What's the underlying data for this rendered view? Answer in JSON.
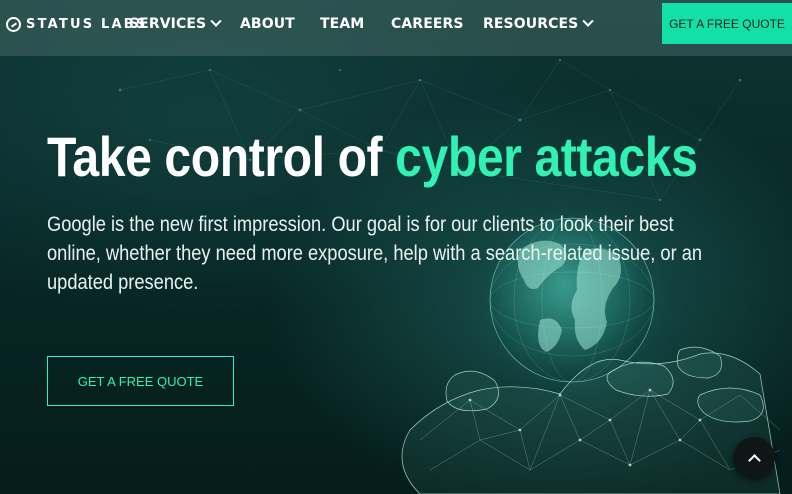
{
  "brand": {
    "name": "STATUS LABS",
    "logo_icon": "status-labs-logo-icon"
  },
  "nav": {
    "items": [
      {
        "label": "SERVICES",
        "has_dropdown": true
      },
      {
        "label": "ABOUT",
        "has_dropdown": false
      },
      {
        "label": "TEAM",
        "has_dropdown": false
      },
      {
        "label": "CAREERS",
        "has_dropdown": false
      },
      {
        "label": "RESOURCES",
        "has_dropdown": true
      }
    ],
    "cta_label": "GET A FREE QUOTE"
  },
  "hero": {
    "headline_plain": "Take control of",
    "headline_accent": "cyber attacks",
    "subtext": "Google is the new first impression. Our goal is for our clients to look their best online, whether they need more exposure, help with a search-related issue, or an updated presence.",
    "cta_label": "GET A FREE QUOTE",
    "background_image": "wireframe-hand-holding-globe"
  },
  "scroll_top": {
    "icon": "chevron-up-icon"
  },
  "colors": {
    "accent": "#2ff2b4",
    "cta_background": "#12e0a6",
    "background": "#06201f",
    "navbar": "#5f7b79"
  }
}
